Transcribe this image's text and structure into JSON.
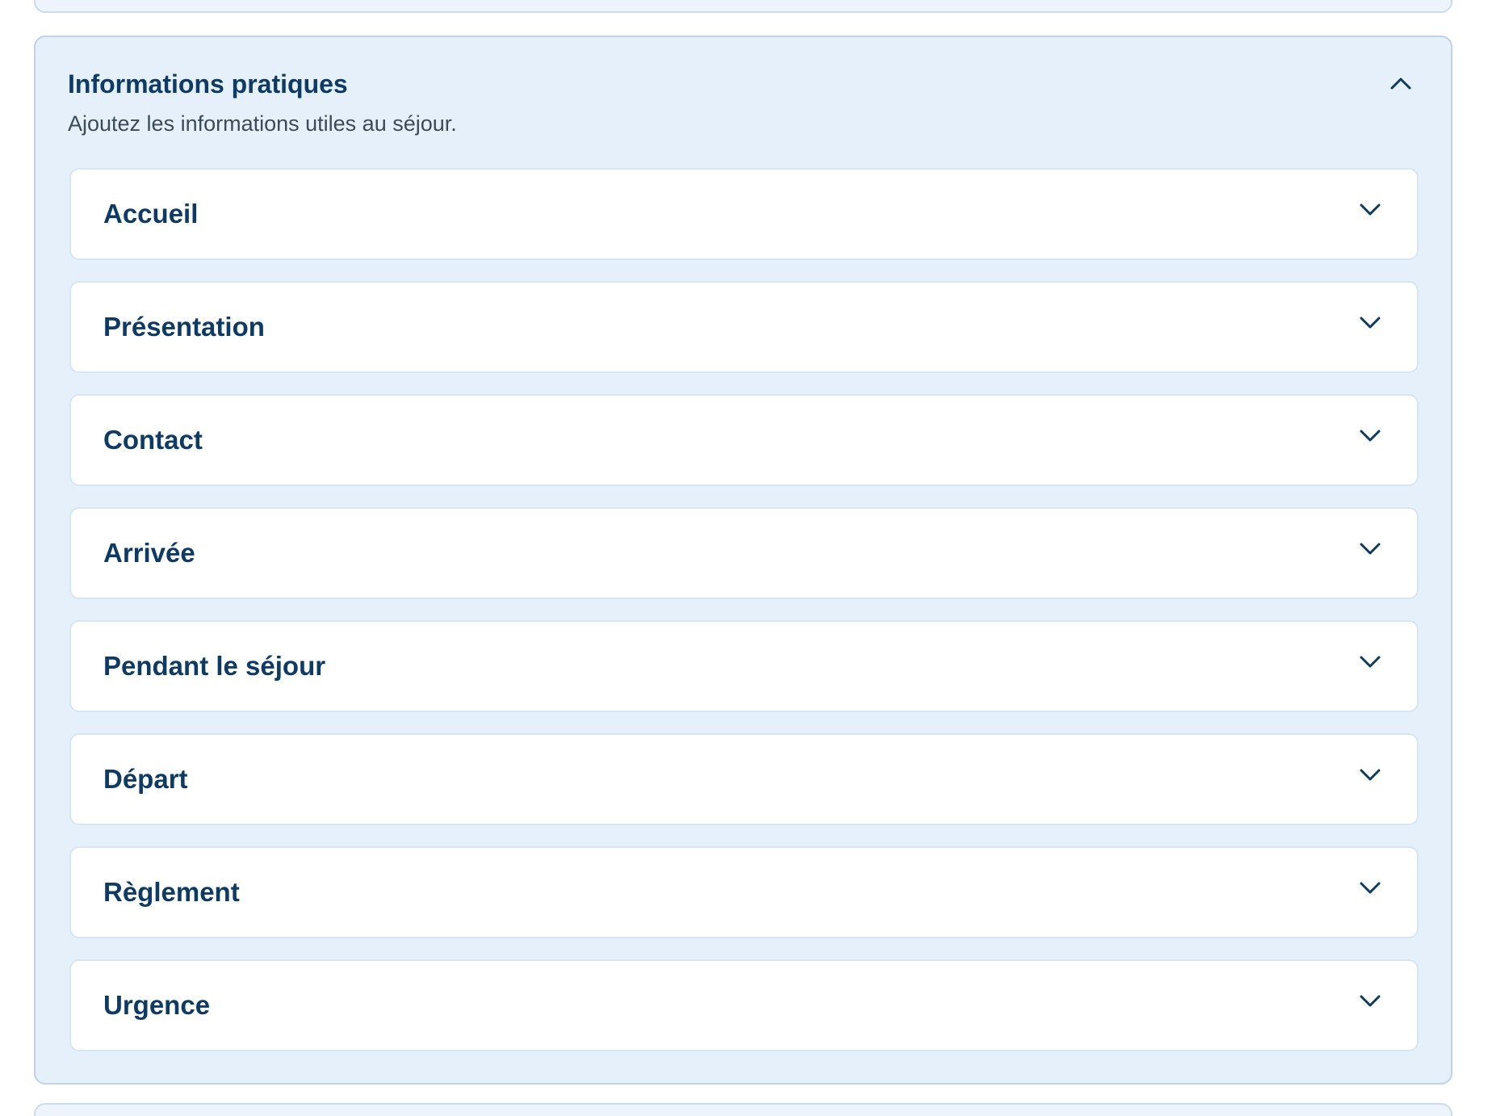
{
  "section": {
    "title": "Informations pratiques",
    "subtitle": "Ajoutez les informations utiles au séjour.",
    "expanded": true,
    "collapse_icon": "chevron-up-icon"
  },
  "items": [
    {
      "label": "Accueil",
      "icon": "chevron-down-icon"
    },
    {
      "label": "Présentation",
      "icon": "chevron-down-icon"
    },
    {
      "label": "Contact",
      "icon": "chevron-down-icon"
    },
    {
      "label": "Arrivée",
      "icon": "chevron-down-icon"
    },
    {
      "label": "Pendant le séjour",
      "icon": "chevron-down-icon"
    },
    {
      "label": "Départ",
      "icon": "chevron-down-icon"
    },
    {
      "label": "Règlement",
      "icon": "chevron-down-icon"
    },
    {
      "label": "Urgence",
      "icon": "chevron-down-icon"
    }
  ],
  "colors": {
    "title": "#0d3b66",
    "subtitle": "#3d4a57",
    "section_bg": "#e6f0fa",
    "section_border": "#bcd3ea",
    "item_bg": "#ffffff",
    "item_border": "#d7e6f4"
  }
}
